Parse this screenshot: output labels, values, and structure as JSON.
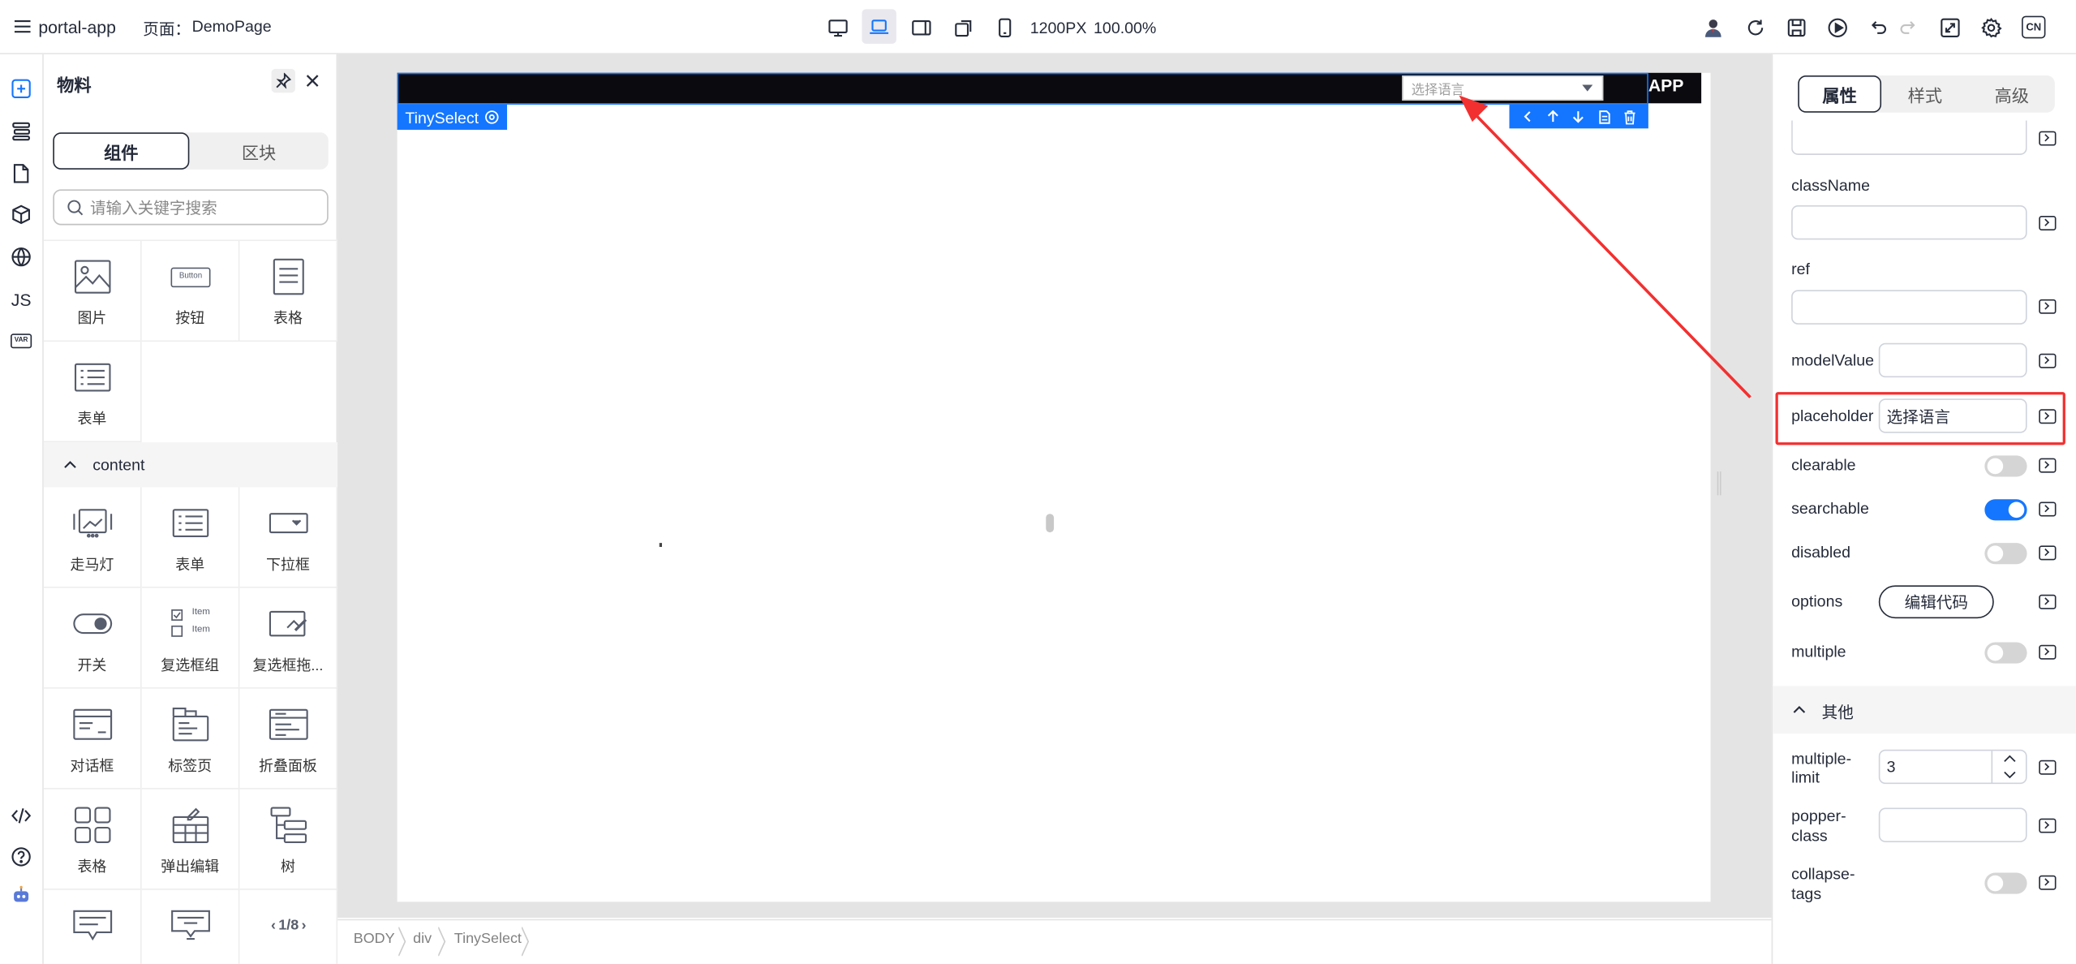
{
  "topbar": {
    "app_name": "portal-app",
    "page_label": "页面：",
    "page_name": "DemoPage",
    "canvas_width": "1200PX",
    "zoom": "100.00%",
    "lang_badge": "CN"
  },
  "rail": {
    "js_label": "JS",
    "var_label": "VAR"
  },
  "materials": {
    "title": "物料",
    "tab_components": "组件",
    "tab_blocks": "区块",
    "search_placeholder": "请输入关键字搜索",
    "items_top": [
      "图片",
      "按钮",
      "表格",
      "表单"
    ],
    "button_preview_text": "Button",
    "group_content": "content",
    "items_content": [
      "走马灯",
      "表单",
      "下拉框",
      "开关",
      "复选框组",
      "复选框拖...",
      "对话框",
      "标签页",
      "折叠面板",
      "表格",
      "弹出编辑",
      "树"
    ],
    "checkbox_preview_text": "Item",
    "pager_text": "1/8"
  },
  "canvas": {
    "select_placeholder": "选择语言",
    "header_right_text": "APP",
    "selected_component": "TinySelect"
  },
  "breadcrumb": [
    "BODY",
    "div",
    "TinySelect"
  ],
  "props": {
    "tabs": [
      "属性",
      "样式",
      "高级"
    ],
    "active_tab": "属性",
    "fields": {
      "className": "className",
      "ref": "ref",
      "modelValue": "modelValue",
      "placeholder": "placeholder",
      "placeholder_value": "选择语言",
      "clearable": "clearable",
      "searchable": "searchable",
      "disabled": "disabled",
      "options": "options",
      "options_button": "编辑代码",
      "multiple": "multiple"
    },
    "toggles": {
      "clearable": false,
      "searchable": true,
      "disabled": false,
      "multiple": false,
      "collapse_tags": false
    },
    "other_group": "其他",
    "other": {
      "multiple_limit_line1": "multiple-",
      "multiple_limit_line2": "limit",
      "multiple_limit_value": "3",
      "popper_class_line1": "popper-",
      "popper_class_line2": "class",
      "collapse_tags_line1": "collapse-",
      "collapse_tags_line2": "tags"
    }
  },
  "colors": {
    "accent": "#1476ff",
    "highlight": "#f23030",
    "canvas_header": "#0b0b0f"
  }
}
